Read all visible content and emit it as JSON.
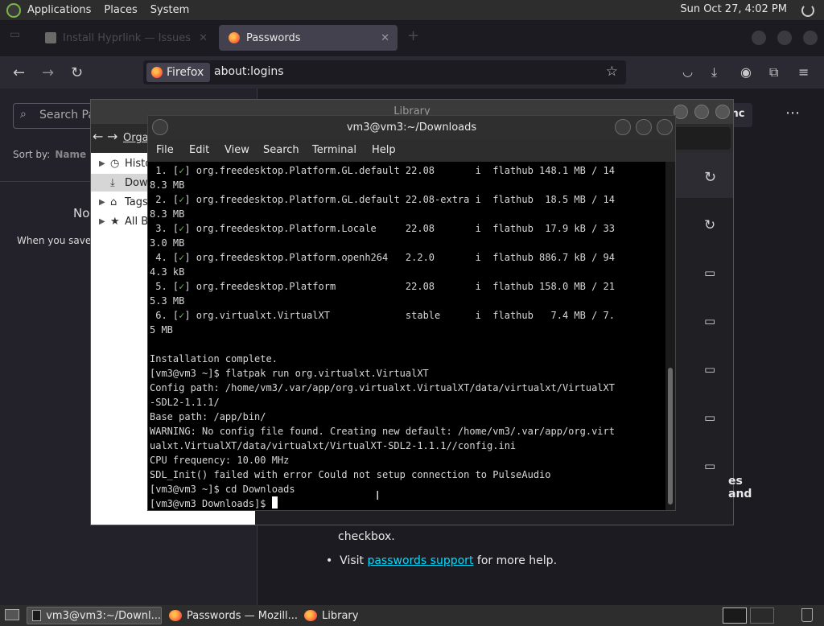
{
  "top_panel": {
    "menus": [
      "Applications",
      "Places",
      "System"
    ],
    "clock": "Sun Oct 27,  4:02 PM"
  },
  "firefox": {
    "tabs": [
      {
        "label": "Install Hyprlink — Issues"
      },
      {
        "label": "Passwords"
      }
    ],
    "identity_label": "Firefox",
    "url": "about:logins"
  },
  "logins": {
    "search_placeholder": "Search Pa",
    "sort_label": "Sort by:",
    "sort_value": "Name (",
    "empty_title": "No",
    "empty_desc": "When you save a",
    "sync_label": "ync",
    "more_label": "⋯",
    "right_text": "es and",
    "checkbox_text": "checkbox.",
    "visit_prefix": "Visit ",
    "visit_link": "passwords support",
    "visit_suffix": " for more help."
  },
  "library": {
    "title": "Library",
    "organize": "Orga",
    "tree": [
      {
        "label": "Histo",
        "icon": "clock-icon"
      },
      {
        "label": "Dow",
        "icon": "download-icon"
      },
      {
        "label": "Tags",
        "icon": "tag-icon"
      },
      {
        "label": "All B",
        "icon": "star-icon"
      }
    ],
    "right_text": "es and"
  },
  "terminal": {
    "title": "vm3@vm3:~/Downloads",
    "menu": [
      "File",
      "Edit",
      "View",
      "Search",
      "Terminal",
      "Help"
    ],
    "lines": [
      {
        "pre": " 1. [",
        "chk": "✓",
        "post": "] org.freedesktop.Platform.GL.default 22.08       i  flathub 148.1 MB / 14"
      },
      {
        "pre": "8.3 MB",
        "chk": "",
        "post": ""
      },
      {
        "pre": " 2. [",
        "chk": "✓",
        "post": "] org.freedesktop.Platform.GL.default 22.08-extra i  flathub  18.5 MB / 14"
      },
      {
        "pre": "8.3 MB",
        "chk": "",
        "post": ""
      },
      {
        "pre": " 3. [",
        "chk": "✓",
        "post": "] org.freedesktop.Platform.Locale     22.08       i  flathub  17.9 kB / 33"
      },
      {
        "pre": "3.0 MB",
        "chk": "",
        "post": ""
      },
      {
        "pre": " 4. [",
        "chk": "✓",
        "post": "] org.freedesktop.Platform.openh264   2.2.0       i  flathub 886.7 kB / 94"
      },
      {
        "pre": "4.3 kB",
        "chk": "",
        "post": ""
      },
      {
        "pre": " 5. [",
        "chk": "✓",
        "post": "] org.freedesktop.Platform            22.08       i  flathub 158.0 MB / 21"
      },
      {
        "pre": "5.3 MB",
        "chk": "",
        "post": ""
      },
      {
        "pre": " 6. [",
        "chk": "✓",
        "post": "] org.virtualxt.VirtualXT             stable      i  flathub   7.4 MB / 7."
      },
      {
        "pre": "5 MB",
        "chk": "",
        "post": ""
      },
      {
        "pre": "",
        "chk": "",
        "post": ""
      },
      {
        "pre": "Installation complete.",
        "chk": "",
        "post": ""
      },
      {
        "pre": "[vm3@vm3 ~]$ flatpak run org.virtualxt.VirtualXT",
        "chk": "",
        "post": ""
      },
      {
        "pre": "Config path: /home/vm3/.var/app/org.virtualxt.VirtualXT/data/virtualxt/VirtualXT",
        "chk": "",
        "post": ""
      },
      {
        "pre": "-SDL2-1.1.1/",
        "chk": "",
        "post": ""
      },
      {
        "pre": "Base path: /app/bin/",
        "chk": "",
        "post": ""
      },
      {
        "pre": "WARNING: No config file found. Creating new default: /home/vm3/.var/app/org.virt",
        "chk": "",
        "post": ""
      },
      {
        "pre": "ualxt.VirtualXT/data/virtualxt/VirtualXT-SDL2-1.1.1//config.ini",
        "chk": "",
        "post": ""
      },
      {
        "pre": "CPU frequency: 10.00 MHz",
        "chk": "",
        "post": ""
      },
      {
        "pre": "SDL_Init() failed with error Could not setup connection to PulseAudio",
        "chk": "",
        "post": ""
      },
      {
        "pre": "[vm3@vm3 ~]$ cd Downloads",
        "chk": "",
        "post": ""
      }
    ],
    "prompt": "[vm3@vm3 Downloads]$ "
  },
  "taskbar": {
    "tasks": [
      {
        "label": "vm3@vm3:~/Downl..."
      },
      {
        "label": "Passwords — Mozill..."
      },
      {
        "label": "Library"
      }
    ]
  }
}
